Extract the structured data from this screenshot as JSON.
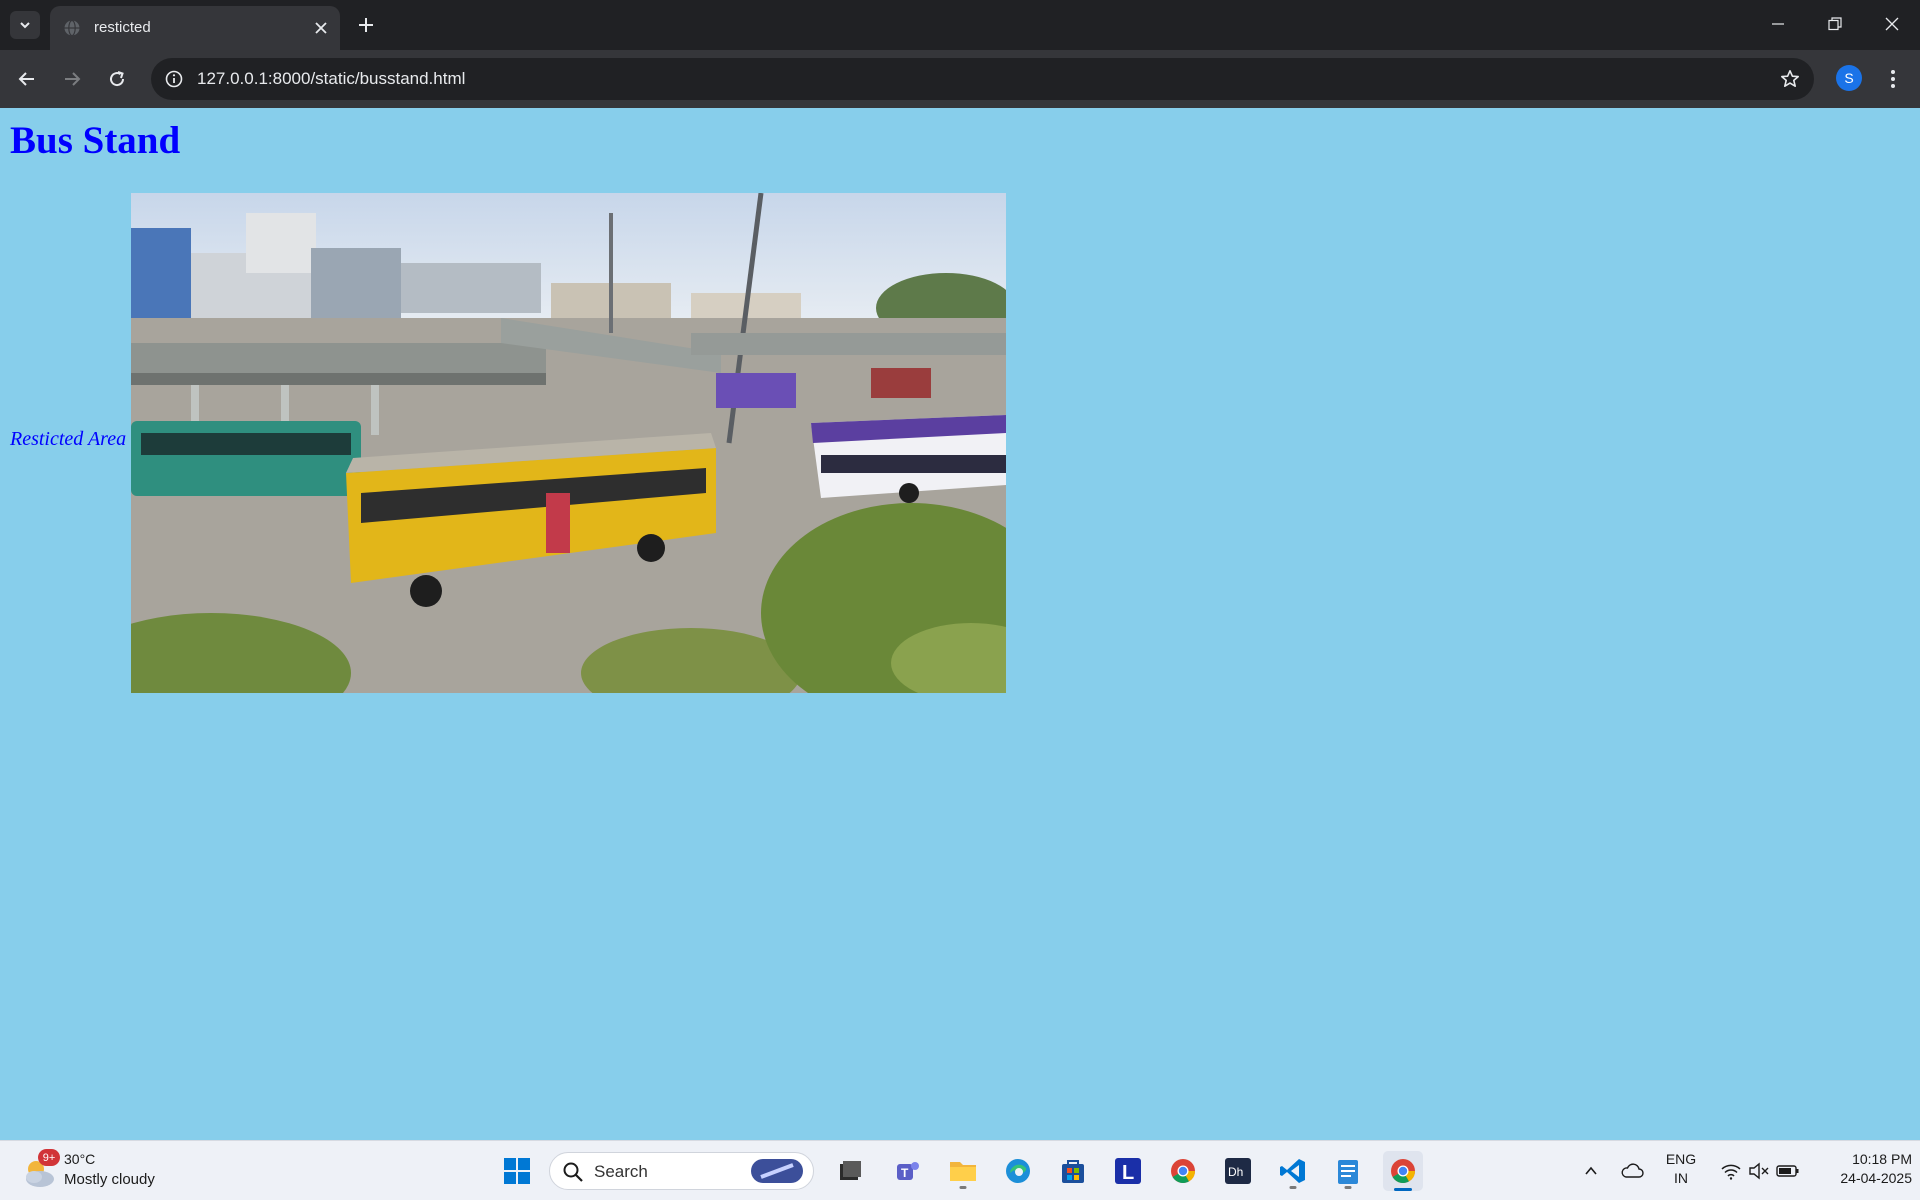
{
  "browser": {
    "tab": {
      "title": "resticted"
    },
    "url": "127.0.0.1:8000/static/busstand.html",
    "profile_initial": "S"
  },
  "page": {
    "heading": "Bus Stand",
    "link_text": "Resticted Area",
    "background_color": "#87ceeb",
    "text_color": "#0000ff"
  },
  "taskbar": {
    "weather": {
      "temp": "30°C",
      "desc": "Mostly cloudy",
      "badge": "9+"
    },
    "search_label": "Search",
    "lang_line1": "ENG",
    "lang_line2": "IN",
    "time": "10:18 PM",
    "date": "24-04-2025",
    "apps": [
      "windows-start",
      "search",
      "task-view",
      "file-manager",
      "teams",
      "file-explorer",
      "edge",
      "microsoft-store",
      "l-app",
      "chrome",
      "dh-app",
      "vs-code",
      "notepad",
      "chrome"
    ]
  }
}
